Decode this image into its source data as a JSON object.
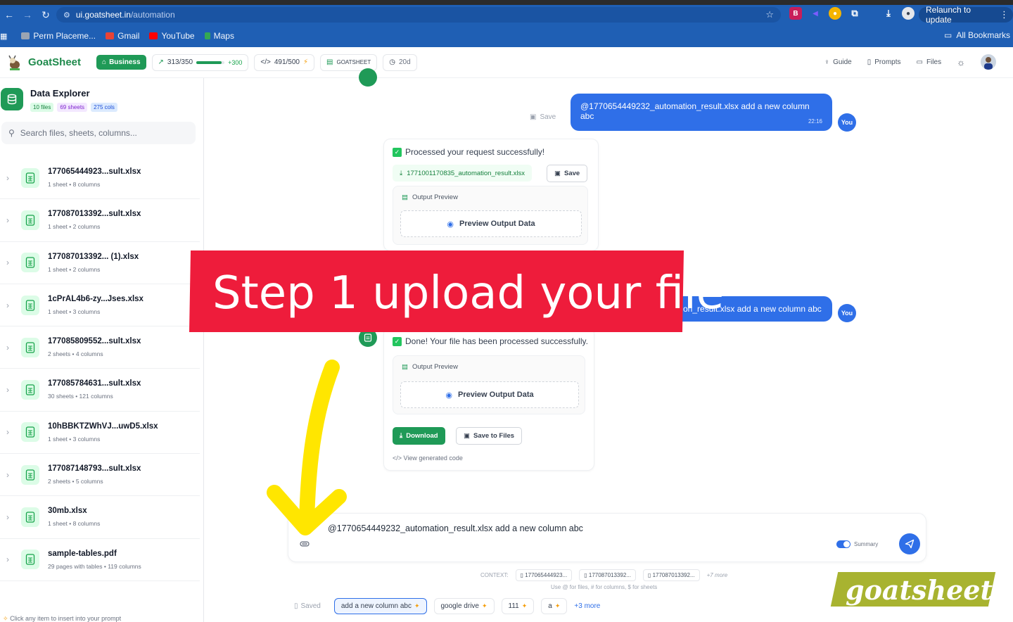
{
  "browser": {
    "url_host": "ui.goatsheet.in",
    "url_path": "/automation",
    "relaunch_label": "Relaunch to update",
    "bookmarks": [
      {
        "label": "Perm Placeme...",
        "color": "#9aa4b2"
      },
      {
        "label": "Gmail",
        "color": "#ea4335"
      },
      {
        "label": "YouTube",
        "color": "#ff0000"
      },
      {
        "label": "Maps",
        "color": "#34a853"
      }
    ],
    "all_bookmarks_label": "All Bookmarks"
  },
  "header": {
    "logo_text": "GoatSheet",
    "business_label": "Business",
    "stat_1": {
      "value": "313/350",
      "extra": "+300",
      "progress": 0.89
    },
    "stat_2": {
      "value": "491/500"
    },
    "goatsheet_label": "GOATSHEET",
    "days_label": "20d",
    "nav": {
      "guide": "Guide",
      "prompts": "Prompts",
      "files": "Files"
    }
  },
  "sidebar": {
    "title": "Data Explorer",
    "tags": {
      "files": "10 files",
      "sheets": "69 sheets",
      "cols": "275 cols"
    },
    "search_placeholder": "Search files, sheets, columns...",
    "files": [
      {
        "name": "177065444923...sult.xlsx",
        "meta": "1 sheet • 8 columns"
      },
      {
        "name": "177087013392...sult.xlsx",
        "meta": "1 sheet • 2 columns"
      },
      {
        "name": "177087013392... (1).xlsx",
        "meta": "1 sheet • 2 columns"
      },
      {
        "name": "1cPrAL4b6-zy...Jses.xlsx",
        "meta": "1 sheet • 3 columns"
      },
      {
        "name": "177085809552...sult.xlsx",
        "meta": "2 sheets • 4 columns"
      },
      {
        "name": "177085784631...sult.xlsx",
        "meta": "30 sheets • 121 columns"
      },
      {
        "name": "10hBBKTZWhVJ...uwD5.xlsx",
        "meta": "1 sheet • 3 columns"
      },
      {
        "name": "177087148793...sult.xlsx",
        "meta": "2 sheets • 5 columns"
      },
      {
        "name": "30mb.xlsx",
        "meta": "1 sheet • 8 columns"
      },
      {
        "name": "sample-tables.pdf",
        "meta": "29 pages with tables • 119 columns"
      }
    ],
    "footer": "Click any item to insert into your prompt"
  },
  "chat": {
    "save_label": "Save",
    "user_msg_1": {
      "text": "@1770654449232_automation_result.xlsx   add a new column abc",
      "time": "22:16"
    },
    "you_label": "You",
    "bot_1": {
      "message": "Processed your request successfully!",
      "file_chip": "1771001170835_automation_result.xlsx",
      "save_button": "Save",
      "output_preview": "Output Preview",
      "preview_button": "Preview Output Data"
    },
    "user_msg_2": {
      "text": "tion_result.xlsx   add a new column abc"
    },
    "bot_2": {
      "message": "Done! Your file has been processed successfully.",
      "output_preview": "Output Preview",
      "preview_button": "Preview Output Data",
      "download": "Download",
      "save_to_files": "Save to Files",
      "view_code": "View generated code"
    }
  },
  "input": {
    "text": "@1770654449232_automation_result.xlsx   add a new column abc",
    "summary_label": "Summary"
  },
  "context": {
    "label": "CONTEXT:",
    "chips": [
      "177065444923...",
      "177087013392...",
      "177087013392..."
    ],
    "more": "+7 more",
    "hint": "Use @ for files, # for columns, $ for sheets"
  },
  "suggestions": {
    "saved": "Saved",
    "items": [
      "add a new column abc",
      "google drive",
      "111",
      "a"
    ],
    "more": "+3 more"
  },
  "overlay": {
    "step_text": "Step 1 upload your file",
    "brand_text": "goatsheet"
  },
  "colors": {
    "accent_green": "#1f9a57",
    "accent_blue": "#2f6fe8",
    "banner_red": "#ee1c3b",
    "arrow_yellow": "#ffe600",
    "brand_olive": "#a8b330"
  }
}
